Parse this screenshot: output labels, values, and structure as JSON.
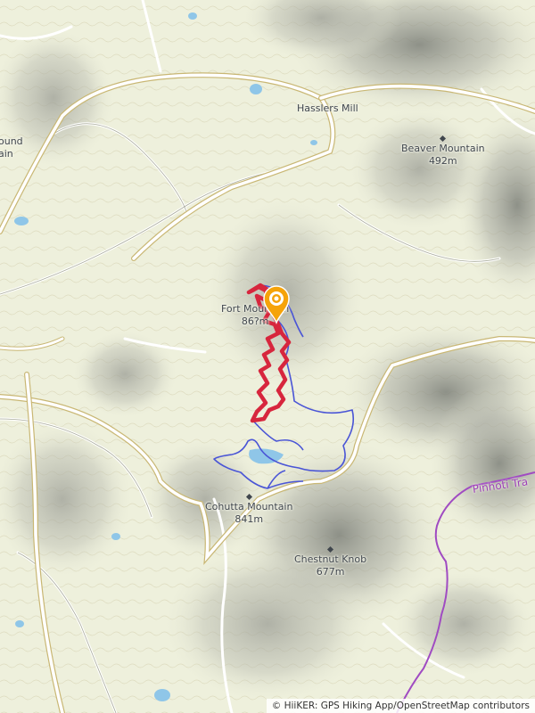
{
  "map": {
    "places": [
      {
        "id": "hasslers-mill",
        "name": "Hasslers Mill",
        "type": "town"
      },
      {
        "id": "beaver-mountain",
        "name": "Beaver Mountain",
        "elevation": "492m",
        "type": "peak"
      },
      {
        "id": "fort-mountain",
        "name": "Fort Mountain",
        "elevation": "86?m",
        "type": "peak"
      },
      {
        "id": "cohutta-mountain",
        "name": "Cohutta Mountain",
        "elevation": "841m",
        "type": "peak"
      },
      {
        "id": "chestnut-knob",
        "name": "Chestnut Knob",
        "elevation": "677m",
        "type": "peak"
      },
      {
        "id": "partial-west",
        "name": "ound ain",
        "type": "peak"
      }
    ],
    "trail_labels": [
      {
        "id": "pinhoti",
        "name": "Pinhoti Tra"
      }
    ],
    "route": {
      "name": "hike route",
      "color": "#d7263d"
    },
    "colors": {
      "background": "#eef0dc",
      "route": "#d7263d",
      "trail": "#4a55d6",
      "pinhoti_trail": "#a04bc2",
      "water": "#8fc6e8",
      "marker": "#f5a30a"
    },
    "attribution": "© HiiKER: GPS Hiking App/OpenStreetMap contributors"
  }
}
